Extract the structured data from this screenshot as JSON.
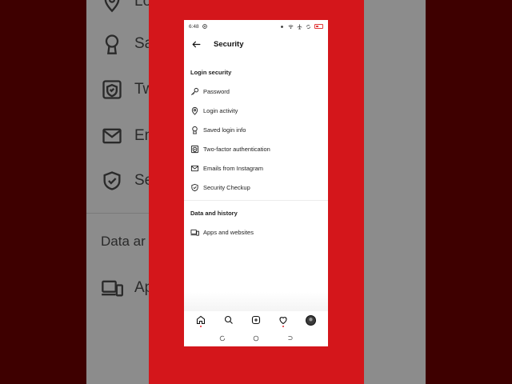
{
  "status_bar": {
    "time": "6:48"
  },
  "header": {
    "title": "Security"
  },
  "sections": {
    "login_security": {
      "label": "Login security",
      "items": [
        {
          "label": "Password",
          "icon": "key-icon"
        },
        {
          "label": "Login activity",
          "icon": "location-pin-icon"
        },
        {
          "label": "Saved login info",
          "icon": "keyhole-icon"
        },
        {
          "label": "Two-factor authentication",
          "icon": "shield-check-icon"
        },
        {
          "label": "Emails from Instagram",
          "icon": "mail-icon"
        },
        {
          "label": "Security Checkup",
          "icon": "shield-check-icon"
        }
      ]
    },
    "data_history": {
      "label": "Data and history",
      "items": [
        {
          "label": "Apps and websites",
          "icon": "laptop-phone-icon"
        }
      ]
    }
  },
  "background_zoom": {
    "rows": [
      {
        "label": "Lo",
        "icon": "location-pin-icon"
      },
      {
        "label": "Sa",
        "icon": "keyhole-icon"
      },
      {
        "label": "Tw",
        "icon": "shield-check-icon"
      },
      {
        "label": "Em",
        "icon": "mail-icon"
      },
      {
        "label": "Se",
        "icon": "shield-check-icon"
      },
      {
        "label": "Ap",
        "icon": "laptop-phone-icon"
      }
    ],
    "section": "Data ar"
  },
  "bottom_nav": [
    "home-icon",
    "search-icon",
    "create-icon",
    "heart-icon",
    "avatar"
  ],
  "colors": {
    "accent_red": "#d4161b",
    "notification_dot": "#e0262f"
  }
}
